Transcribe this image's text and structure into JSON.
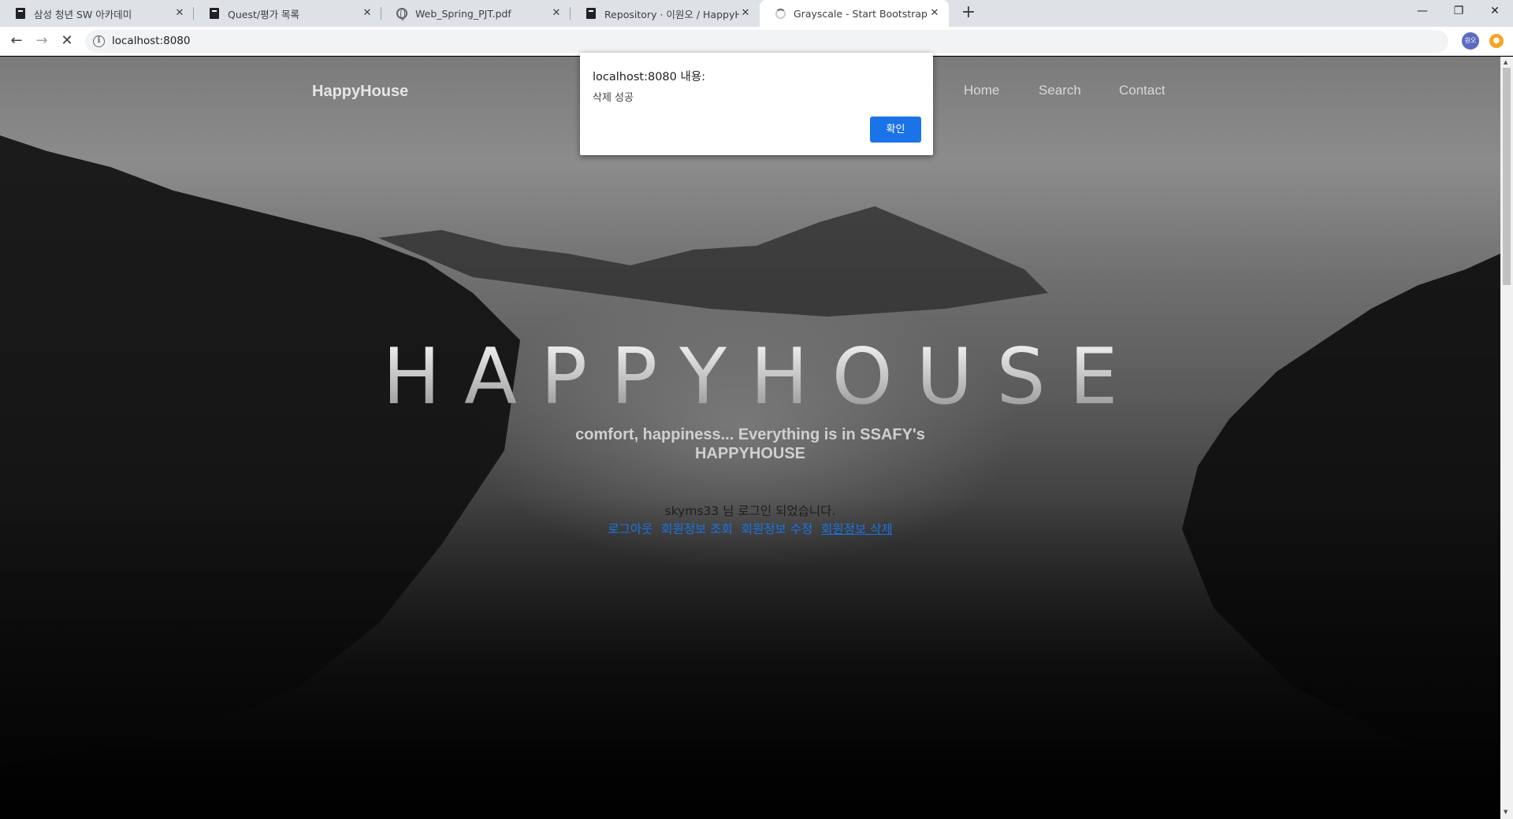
{
  "browser": {
    "tabs": [
      {
        "title": "삼성 청년 SW 아카데미",
        "favicon": "book-icon",
        "active": false
      },
      {
        "title": "Quest/평가 목록",
        "favicon": "book-icon",
        "active": false
      },
      {
        "title": "Web_Spring_PJT.pdf",
        "favicon": "globe-icon",
        "active": false
      },
      {
        "title": "Repository · 이원오 / HappyHou",
        "favicon": "book-icon",
        "active": false
      },
      {
        "title": "Grayscale - Start Bootstrap The",
        "favicon": "loading-spinner-icon",
        "active": true
      }
    ],
    "url": "localhost:8080",
    "profile_initials": "원오"
  },
  "site": {
    "brand": "HappyHouse",
    "nav": [
      "Home",
      "Search",
      "Contact"
    ],
    "hero_title": "HAPPYHOUSE",
    "subtitle": "comfort, happiness... Everything is in SSAFY's HAPPYHOUSE",
    "welcome": "skyms33 님 로그인 되었습니다.",
    "links": [
      "로그아웃",
      "회원정보 조회",
      "회원정보 수정",
      "회원정보 삭제"
    ]
  },
  "dialog": {
    "title": "localhost:8080 내용:",
    "message": "삭제 성공",
    "ok_label": "확인"
  },
  "colors": {
    "accent": "#1a73e8",
    "tabstrip": "#dee1e6"
  }
}
